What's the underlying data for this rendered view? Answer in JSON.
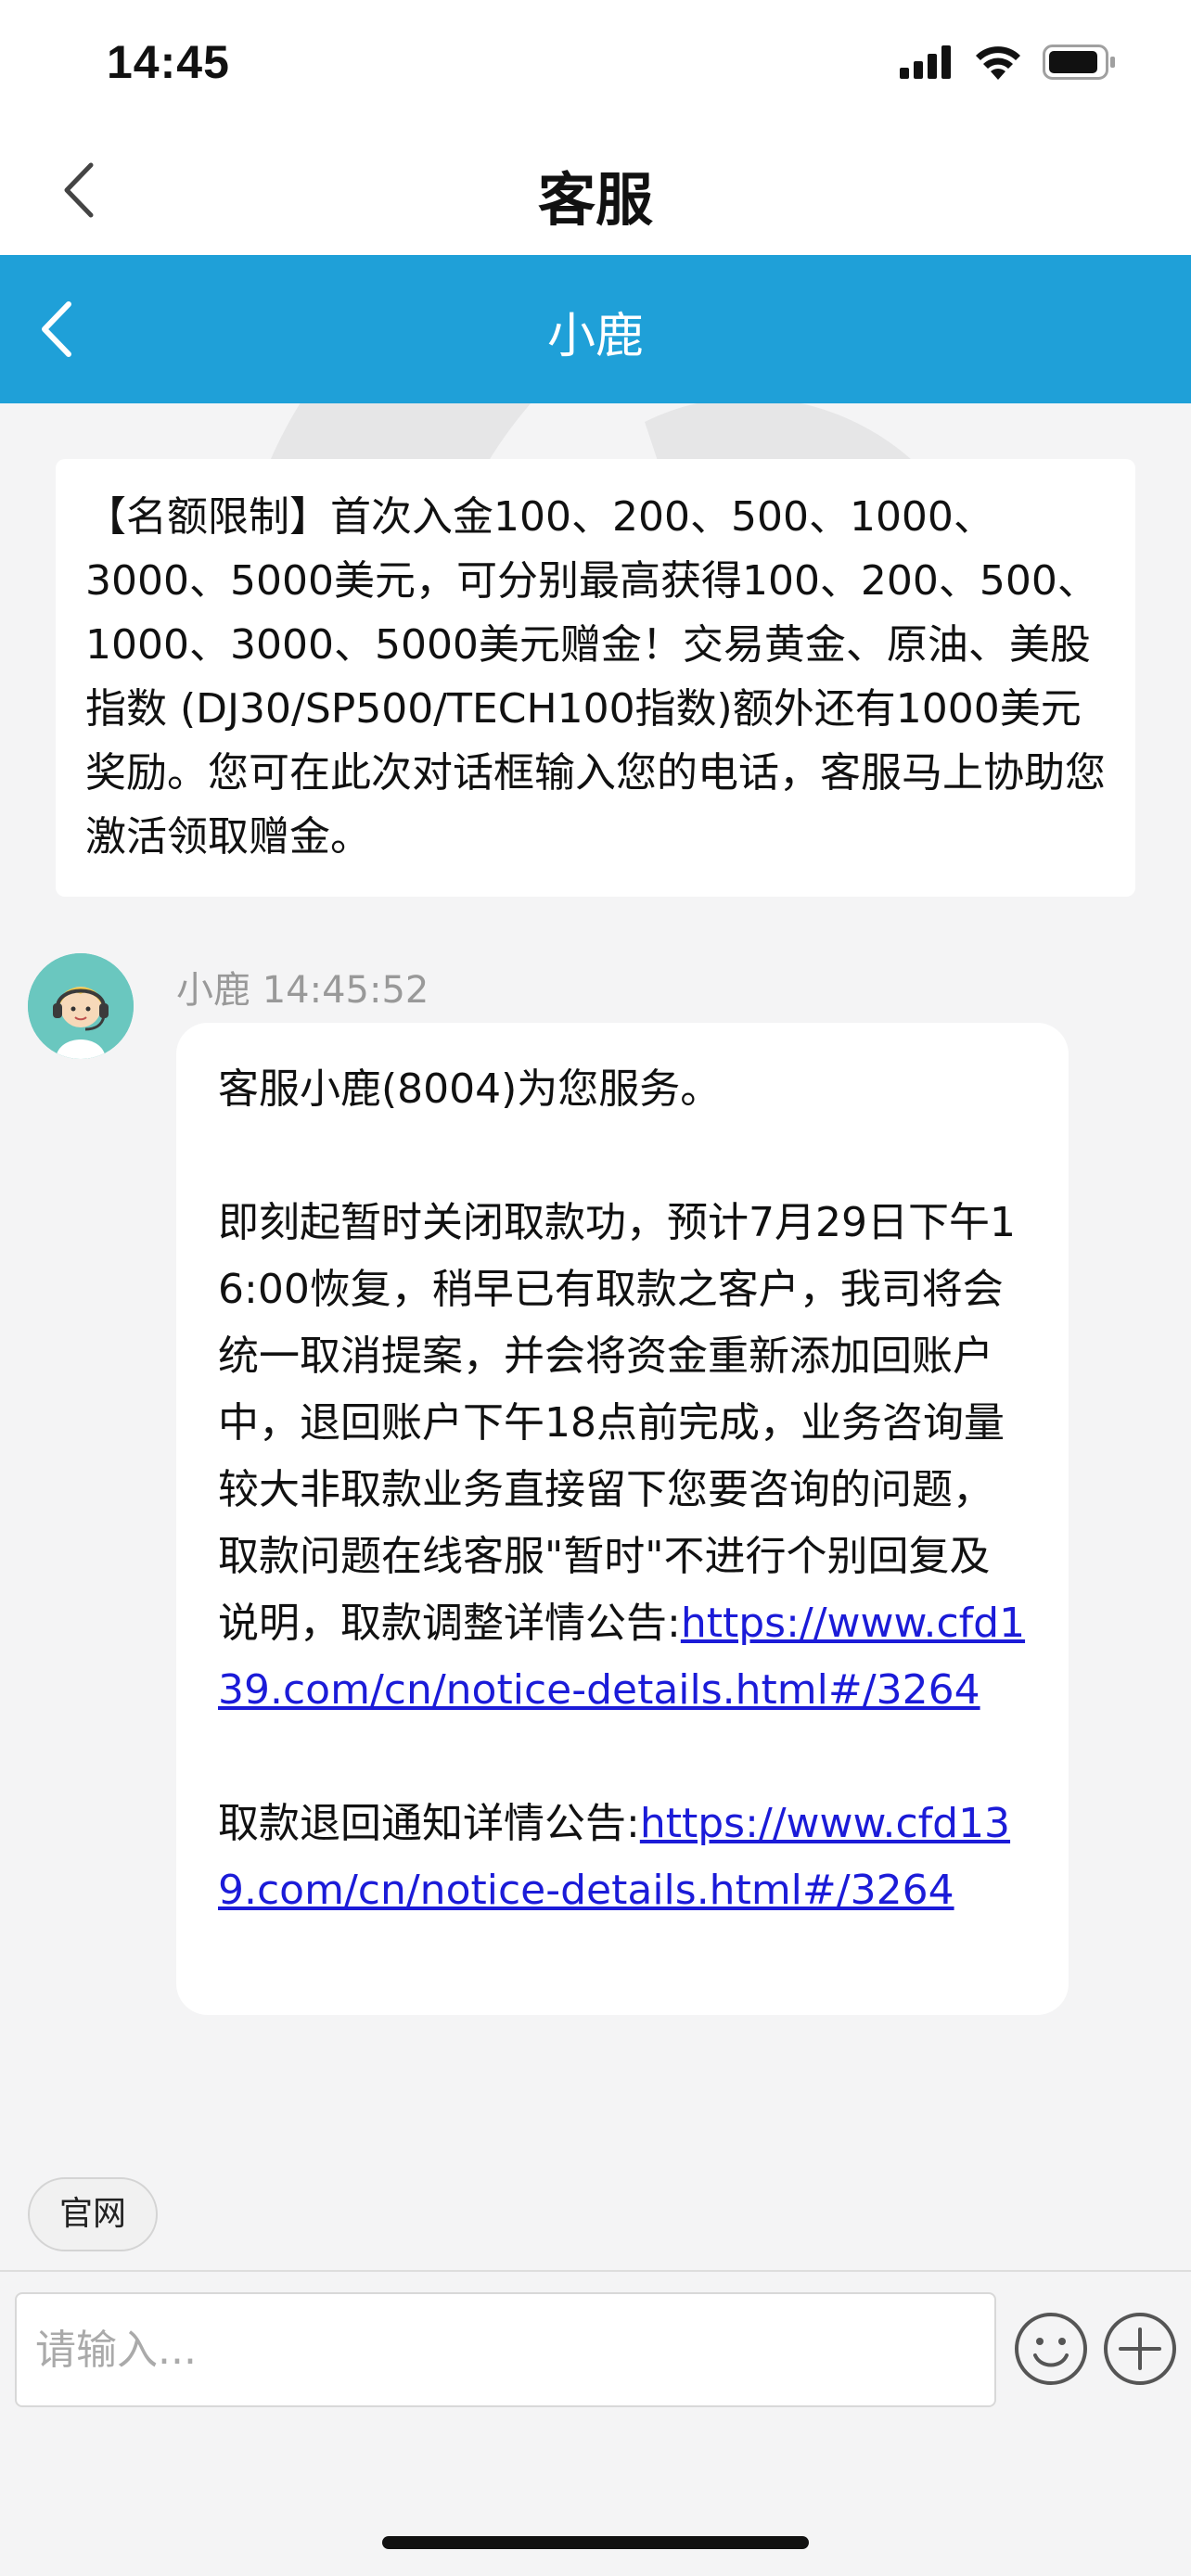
{
  "status": {
    "time": "14:45"
  },
  "nav": {
    "title": "客服"
  },
  "chat_header": {
    "title": "小鹿"
  },
  "notice": {
    "text": "【名额限制】首次入金100、200、500、1000、3000、5000美元，可分别最高获得100、200、500、1000、3000、5000美元赠金！交易黄金、原油、美股指数 (DJ30/SP500/TECH100指数)额外还有1000美元奖励。您可在此次对话框输入您的电话，客服马上协助您激活领取赠金。"
  },
  "message": {
    "sender": "小鹿",
    "time": "14:45:52",
    "greeting": "客服小鹿(8004)为您服务。",
    "body": "即刻起暂时关闭取款功，预计7月29日下午16:00恢复，稍早已有取款之客户，我司将会统一取消提案，并会将资金重新添加回账户中，退回账户下午18点前完成，业务咨询量较大非取款业务直接留下您要咨询的问题，取款问题在线客服\"暂时\"不进行个别回复及说明，取款调整详情公告:",
    "link1": "https://www.cfd139.com/cn/notice-details.html#/3264",
    "notice2": "取款退回通知详情公告:",
    "link2": "https://www.cfd139.com/cn/notice-details.html#/3264"
  },
  "quick_reply": {
    "label": "官网"
  },
  "input": {
    "placeholder": "请输入..."
  },
  "colors": {
    "header_blue": "#1fa0d8",
    "link": "#1b1bd8",
    "avatar_bg": "#6ac7bf"
  },
  "icons": [
    "chevron-left-icon",
    "emoji-icon",
    "plus-icon",
    "signal-icon",
    "wifi-icon",
    "battery-icon"
  ]
}
